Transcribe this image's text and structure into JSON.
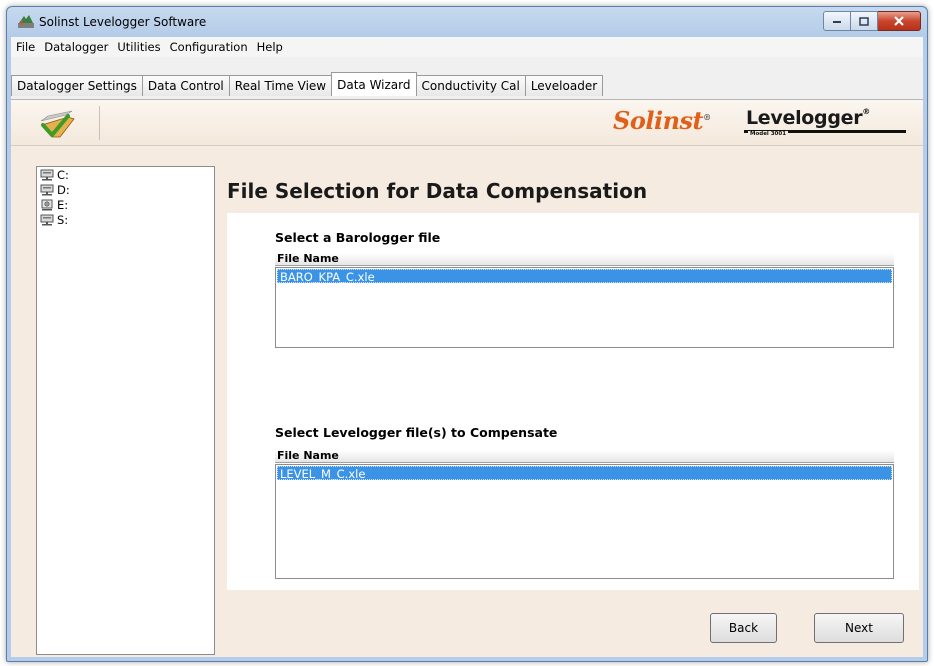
{
  "window": {
    "title": "Solinst Levelogger Software"
  },
  "menu": [
    "File",
    "Datalogger",
    "Utilities",
    "Configuration",
    "Help"
  ],
  "tabs": [
    {
      "label": "Datalogger Settings",
      "active": false
    },
    {
      "label": "Data Control",
      "active": false
    },
    {
      "label": "Real Time View",
      "active": false
    },
    {
      "label": "Data Wizard",
      "active": true
    },
    {
      "label": "Conductivity Cal",
      "active": false
    },
    {
      "label": "Leveloader",
      "active": false
    }
  ],
  "brand": {
    "solinst": "Solinst",
    "levelogger": "Levelogger",
    "model": "Model 3001"
  },
  "drives": [
    {
      "label": "C:",
      "icon": "network-drive-icon"
    },
    {
      "label": "D:",
      "icon": "network-drive-icon"
    },
    {
      "label": "E:",
      "icon": "removable-drive-icon"
    },
    {
      "label": "S:",
      "icon": "network-drive-icon"
    }
  ],
  "page": {
    "heading": "File Selection for Data Compensation"
  },
  "barologger": {
    "label": "Select a Barologger file",
    "column_header": "File Name",
    "files": [
      "BARO_KPA_C.xle"
    ]
  },
  "levelogger": {
    "label": "Select Levelogger file(s) to Compensate",
    "column_header": "File Name",
    "files": [
      "LEVEL_M_C.xle"
    ]
  },
  "buttons": {
    "back": "Back",
    "next": "Next"
  },
  "colors": {
    "selection": "#3b93e6",
    "panel_bg": "#f5ebe0",
    "solinst_orange": "#e0601a"
  }
}
